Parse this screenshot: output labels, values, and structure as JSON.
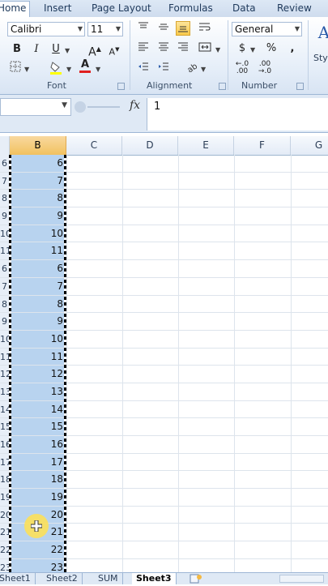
{
  "ribbon": {
    "tabs": [
      "Home",
      "Insert",
      "Page Layout",
      "Formulas",
      "Data",
      "Review"
    ],
    "active_tab": "Home",
    "font": {
      "name": "Calibri",
      "size": "11",
      "group_label": "Font"
    },
    "alignment": {
      "group_label": "Alignment"
    },
    "number": {
      "format": "General",
      "group_label": "Number"
    },
    "styles": {
      "label": "Styl"
    }
  },
  "formula_bar": {
    "fx": "fx",
    "value": "1"
  },
  "grid": {
    "columns": [
      "B",
      "C",
      "D",
      "E",
      "F",
      "G"
    ],
    "selected_column": "B",
    "rows": [
      {
        "rownum": "6",
        "b": "6"
      },
      {
        "rownum": "7",
        "b": "7"
      },
      {
        "rownum": "8",
        "b": "8"
      },
      {
        "rownum": "9",
        "b": "9"
      },
      {
        "rownum": "10",
        "b": "10"
      },
      {
        "rownum": "11",
        "b": "11"
      },
      {
        "rownum": "6",
        "b": "6"
      },
      {
        "rownum": "7",
        "b": "7"
      },
      {
        "rownum": "8",
        "b": "8"
      },
      {
        "rownum": "9",
        "b": "9"
      },
      {
        "rownum": "10",
        "b": "10"
      },
      {
        "rownum": "11",
        "b": "11"
      },
      {
        "rownum": "12",
        "b": "12"
      },
      {
        "rownum": "13",
        "b": "13"
      },
      {
        "rownum": "14",
        "b": "14"
      },
      {
        "rownum": "15",
        "b": "15"
      },
      {
        "rownum": "16",
        "b": "16"
      },
      {
        "rownum": "17",
        "b": "17"
      },
      {
        "rownum": "18",
        "b": "18"
      },
      {
        "rownum": "19",
        "b": "19"
      },
      {
        "rownum": "20",
        "b": "20"
      },
      {
        "rownum": "21",
        "b": "21"
      },
      {
        "rownum": "22",
        "b": "22"
      },
      {
        "rownum": "23",
        "b": "23"
      }
    ]
  },
  "sheets": [
    "Sheet1",
    "Sheet2",
    "SUM",
    "Sheet3"
  ],
  "active_sheet": "Sheet3",
  "colors": {
    "selection": "#b8d3ef",
    "header_selected": "#f1c15f",
    "cursor": "#ffe050"
  }
}
